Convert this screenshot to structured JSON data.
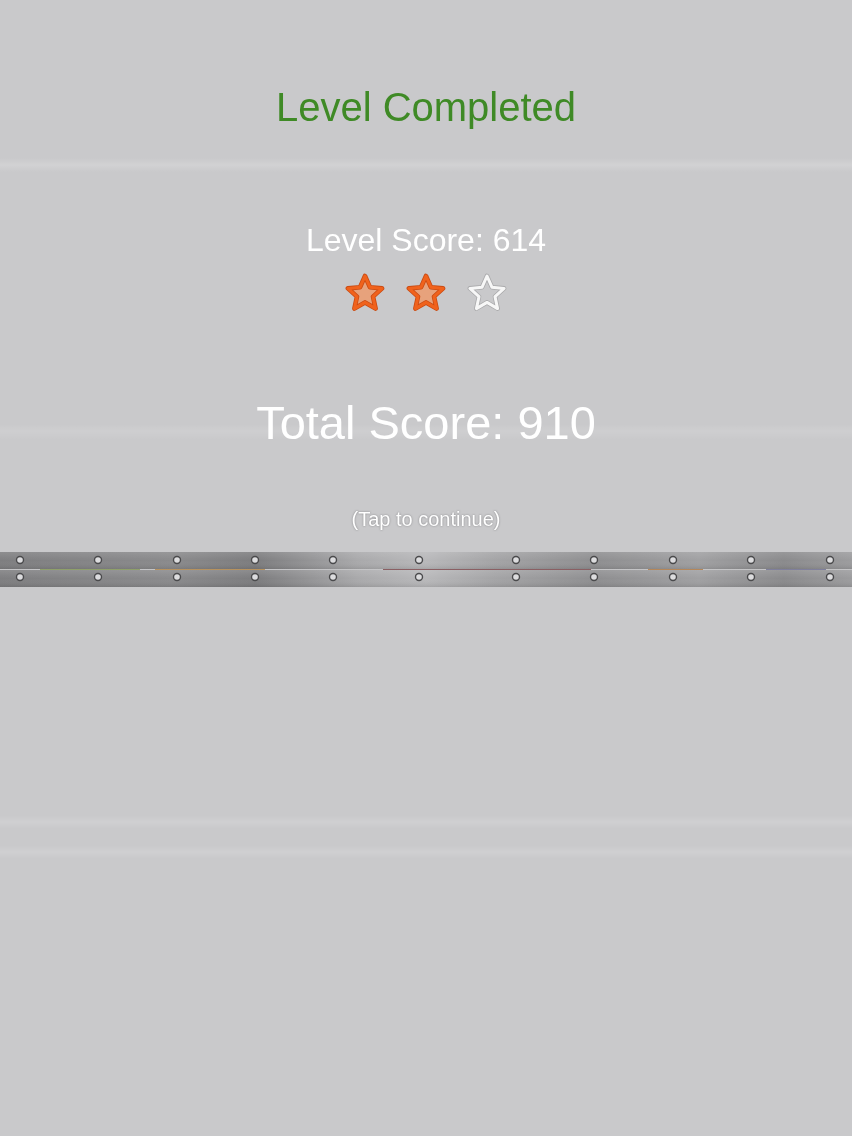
{
  "title": "Level Completed",
  "level_score": "Level Score: 614",
  "rating": {
    "stars": 2
  },
  "total_score": "Total Score: 910",
  "prompt": "(Tap to continue)"
}
